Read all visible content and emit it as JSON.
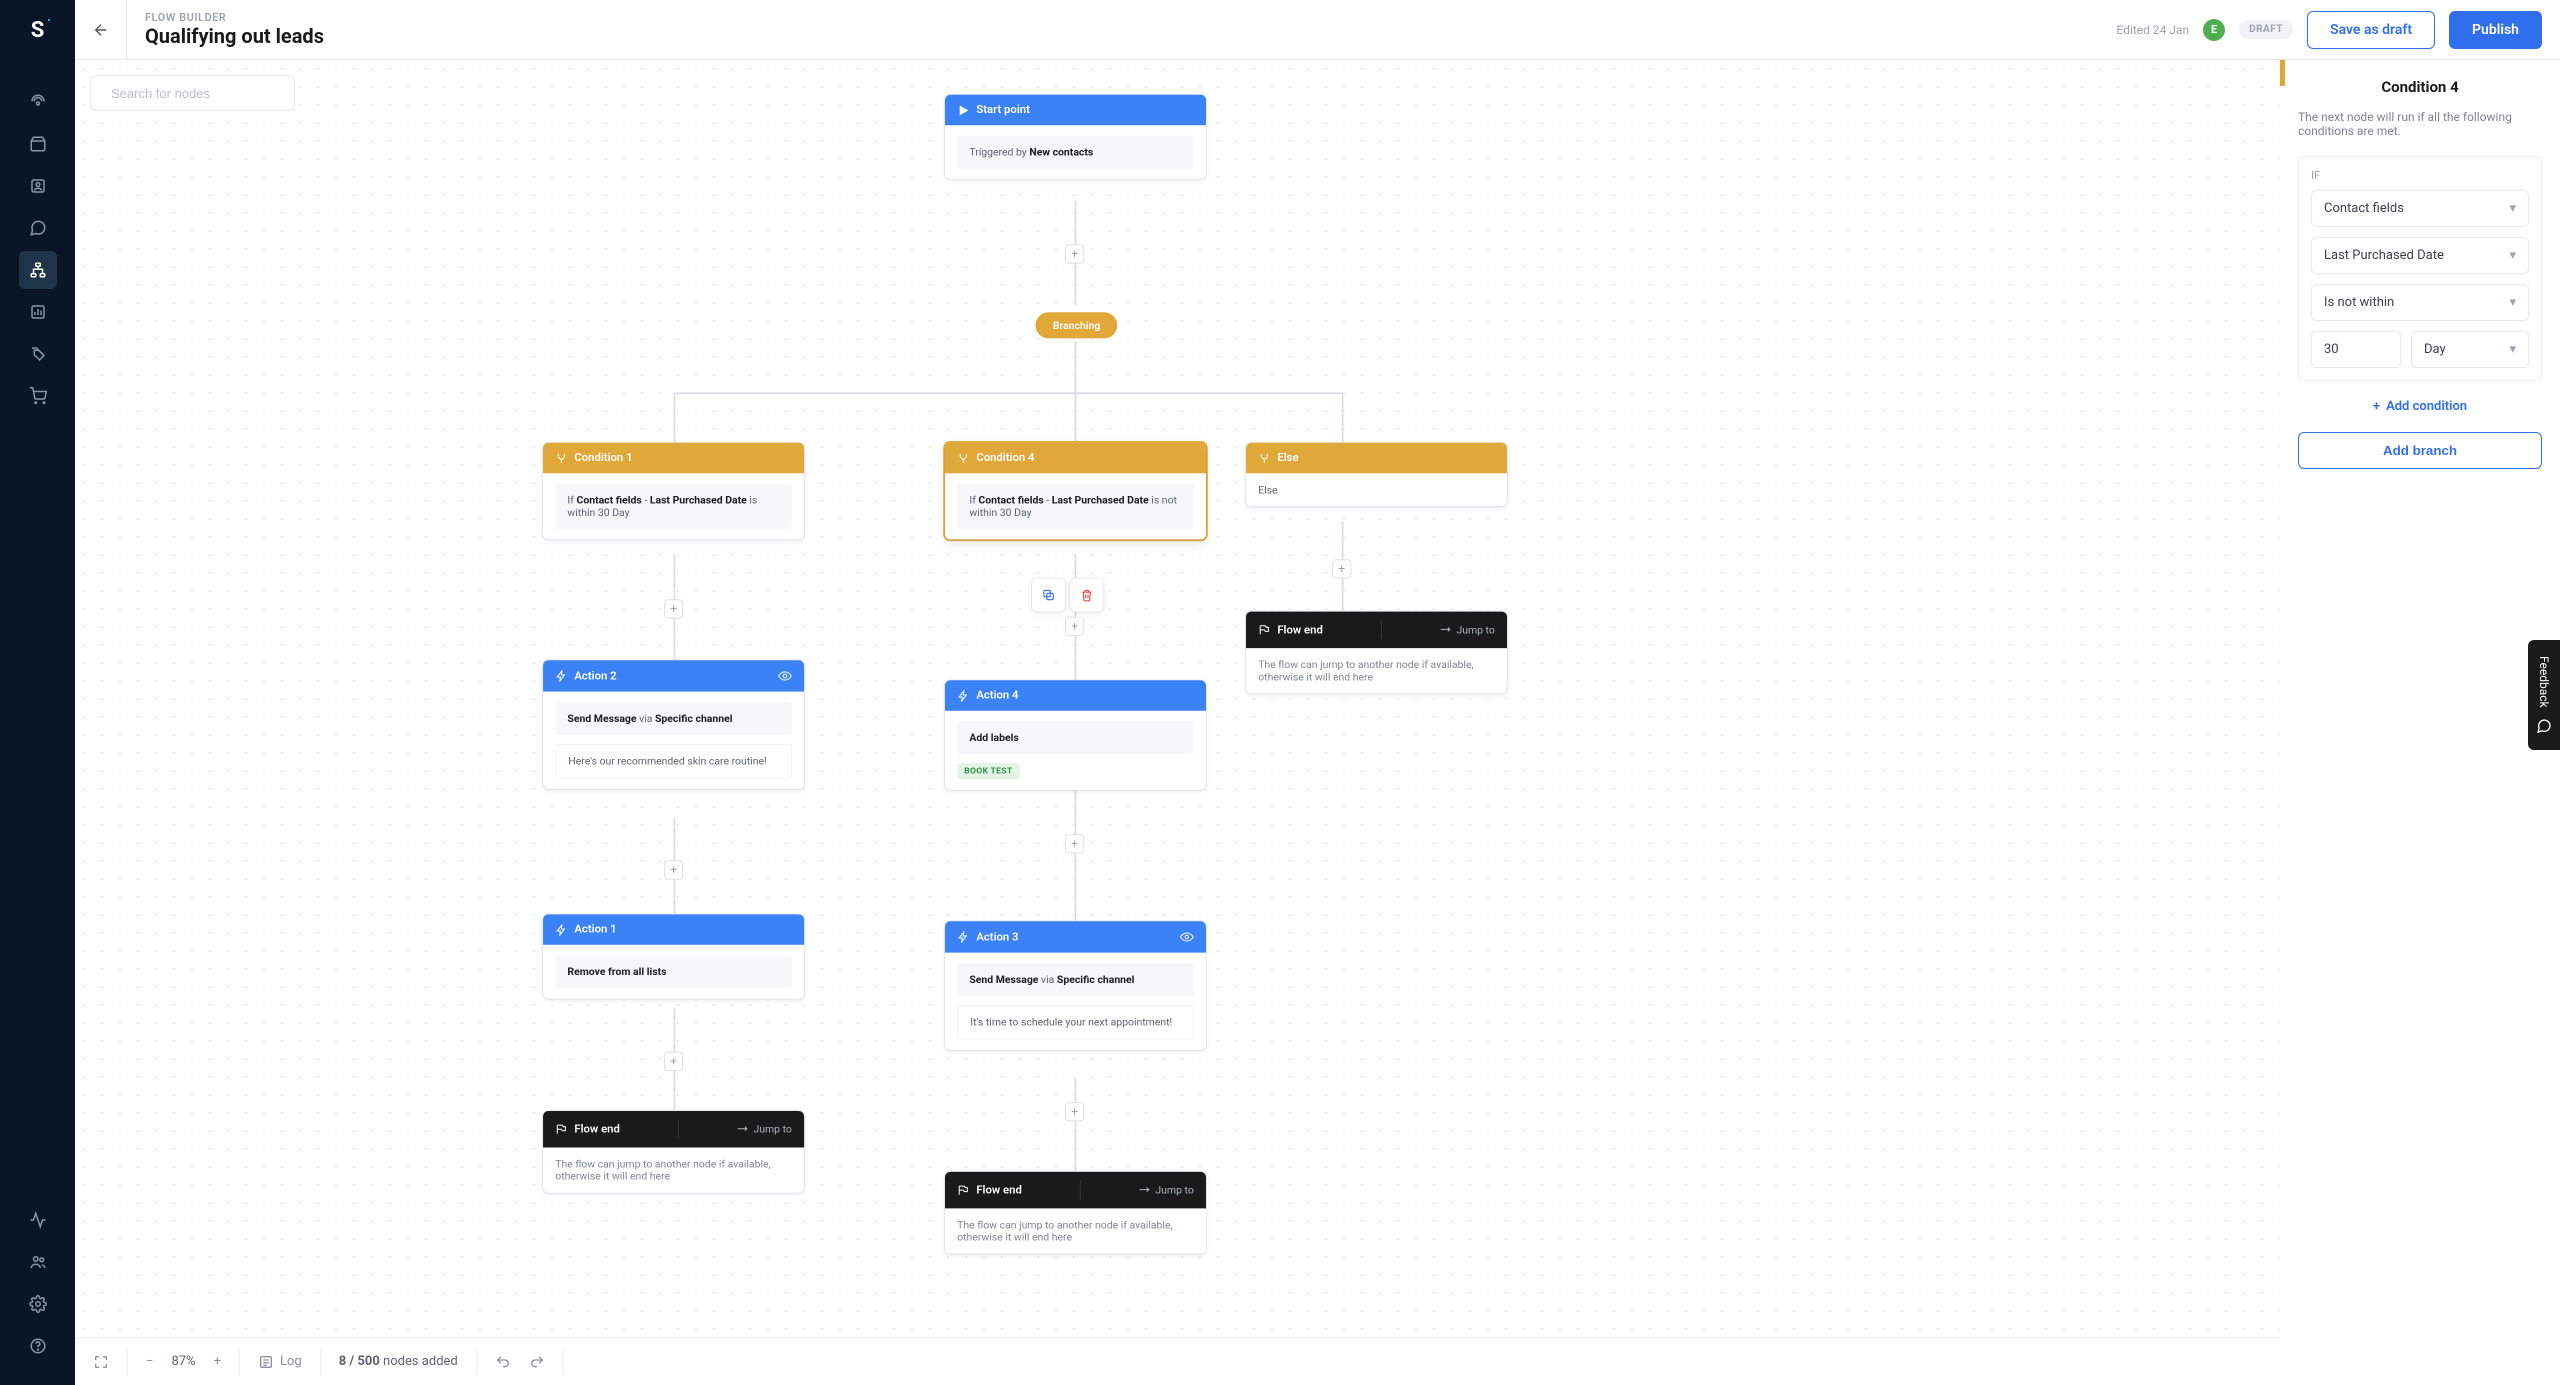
{
  "header": {
    "crumb": "FLOW BUILDER",
    "title": "Qualifying out leads",
    "edited_label": "Edited 24 Jan",
    "avatar_initial": "E",
    "status_badge": "DRAFT",
    "save_draft_label": "Save as draft",
    "publish_label": "Publish"
  },
  "search": {
    "placeholder": "Search for nodes"
  },
  "canvas": {
    "start": {
      "title": "Start point",
      "trigger_pre": "Triggered by ",
      "trigger_bold": "New contacts"
    },
    "branching_label": "Branching",
    "cond1": {
      "title": "Condition 1",
      "if_label": "If ",
      "bold1": "Contact fields",
      "dash": " - ",
      "bold2": "Last Purchased Date",
      "tail": " is within 30 Day"
    },
    "cond4": {
      "title": "Condition 4",
      "if_label": "If ",
      "bold1": "Contact fields",
      "dash": " - ",
      "bold2": "Last Purchased Date",
      "tail": " is not within 30 Day"
    },
    "else": {
      "title": "Else",
      "body": "Else"
    },
    "act2": {
      "title": "Action 2",
      "line_pre": "Send Message ",
      "via": "via ",
      "bold": "Specific channel",
      "preview": "Here's our recommended skin care routine!"
    },
    "act4": {
      "title": "Action 4",
      "body": "Add labels",
      "chip": "BOOK TEST"
    },
    "act1": {
      "title": "Action 1",
      "body": "Remove from all lists"
    },
    "act3": {
      "title": "Action 3",
      "line_pre": "Send Message ",
      "via": "via ",
      "bold": "Specific channel",
      "preview": "It's time to schedule your next appointment!"
    },
    "flowend": {
      "title": "Flow end",
      "jump": "Jump to",
      "desc": "The flow can jump to another node if available, otherwise it will end here"
    }
  },
  "bottom": {
    "zoom": "87%",
    "log": "Log",
    "nodes_count": "8 / 500",
    "nodes_tail": " nodes added"
  },
  "panel": {
    "title": "Condition 4",
    "desc": "The next node will run if all the following conditions are met.",
    "if_label": "IF",
    "sel1": "Contact fields",
    "sel2": "Last Purchased Date",
    "sel3": "Is not within",
    "num": "30",
    "unit": "Day",
    "add_condition": "Add condition",
    "add_branch": "Add branch"
  },
  "feedback": "Feedback"
}
